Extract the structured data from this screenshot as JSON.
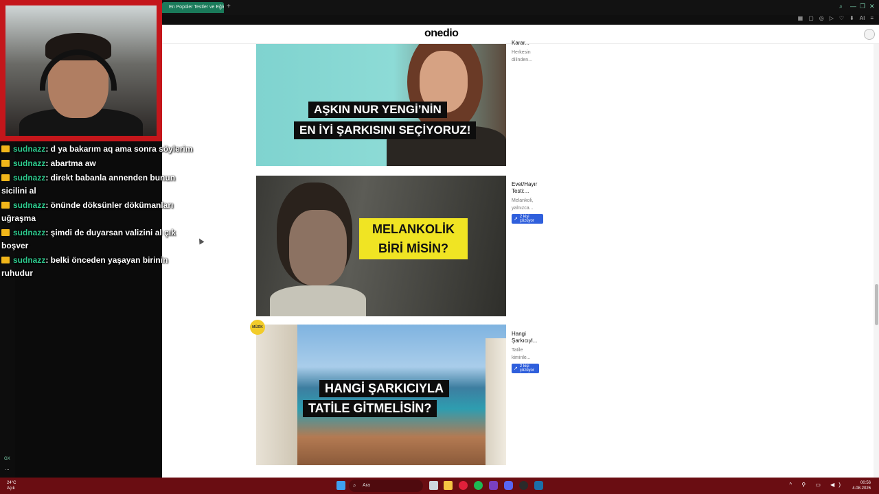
{
  "browser": {
    "tab_title": "En Popüler Testler ve Eğle",
    "new_tab": "+",
    "window_controls": [
      "⌕",
      "—",
      "❐",
      "✕"
    ],
    "toolbar_icons": [
      "▦",
      "▢",
      "◎",
      "▷",
      "♡",
      "⬇",
      "AI",
      "≡"
    ]
  },
  "site": {
    "logo": "onedio"
  },
  "cards": [
    {
      "headline_line1": "AŞKIN NUR YENGİ’NİN",
      "headline_line2": "EN İYİ ŞARKISINI SEÇİYORUZ!",
      "side_title": "Karar...",
      "side_desc_1": "Herkesin",
      "side_desc_2": "dilinden..."
    },
    {
      "headline_line1": "MELANKOLİK",
      "headline_line2": "BİRİ MİSİN?",
      "side_title_1": "Evet/Hayır",
      "side_title_2": "Testi:...",
      "side_desc_1": "Melankoli,",
      "side_desc_2": "yalnızca...",
      "badge": "2 kişi çözüyor"
    },
    {
      "tag": "MÜZİK",
      "headline_line1": "HANGİ ŞARKICIYLA",
      "headline_line2": "TATİLE GİTMELİSİN?",
      "side_title_1": "Hangi",
      "side_title_2": "Şarkıcıyl...",
      "side_desc_1": "Tatile",
      "side_desc_2": "kiminle...",
      "badge": "2 kişi çözüyor"
    }
  ],
  "chat": [
    {
      "user": "sudnazz",
      "text": ": d ya bakarım aq ama sonra söylerim",
      "cont": ""
    },
    {
      "user": "sudnazz",
      "text": ": abartma aw",
      "cont": ""
    },
    {
      "user": "sudnazz",
      "text": ": direkt babanla annenden bunun",
      "cont": "sicilini al"
    },
    {
      "user": "sudnazz",
      "text": ": önünde döksünler dökümanları",
      "cont": "uğraşma"
    },
    {
      "user": "sudnazz",
      "text": ": şimdi de duyarsan valizini al çık",
      "cont": "boşver"
    },
    {
      "user": "sudnazz",
      "text": ": belki önceden yaşayan birinin",
      "cont": "ruhudur"
    }
  ],
  "leftbar": {
    "gx": "GX",
    "more": "..."
  },
  "taskbar": {
    "temp": "24°C",
    "weather": "Açık",
    "search_placeholder": "Ara",
    "search_icon": "⌕",
    "time": "00:56",
    "date": "4.08.2026",
    "tray": "^ ⚲ ▭ ◀)",
    "colors": {
      "start": "#3fa0f0",
      "explorer": "#f5c542",
      "opera": "#e0203a",
      "spotify": "#1db954",
      "discord": "#5865f2",
      "steam": "#1b6fa8"
    }
  }
}
